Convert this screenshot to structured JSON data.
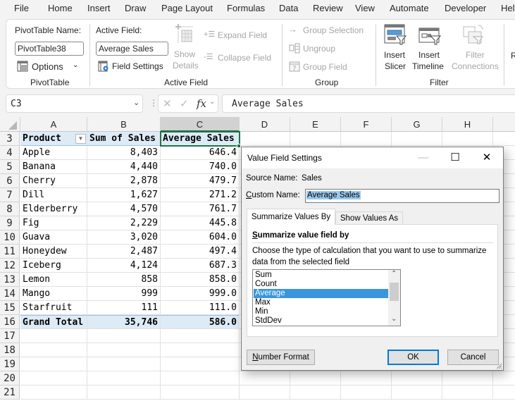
{
  "menu": {
    "tabs": [
      "File",
      "Home",
      "Insert",
      "Draw",
      "Page Layout",
      "Formulas",
      "Data",
      "Review",
      "View",
      "Automate",
      "Developer",
      "Hel"
    ]
  },
  "ribbon": {
    "pivottable": {
      "name_label": "PivotTable Name:",
      "name_value": "PivotTable38",
      "options_label": "Options",
      "group_label": "PivotTable"
    },
    "active_field": {
      "label": "Active Field:",
      "value": "Average Sales",
      "field_settings_label": "Field Settings",
      "show_details_label_1": "Show",
      "show_details_label_2": "Details",
      "expand_label": "Expand Field",
      "collapse_label": "Collapse Field",
      "group_label": "Active Field"
    },
    "group": {
      "group_selection_label": "Group Selection",
      "ungroup_label": "Ungroup",
      "group_field_label": "Group Field",
      "group_label": "Group"
    },
    "filter": {
      "insert_slicer_1": "Insert",
      "insert_slicer_2": "Slicer",
      "insert_timeline_1": "Insert",
      "insert_timeline_2": "Timeline",
      "filter_connections_1": "Filter",
      "filter_connections_2": "Connections",
      "group_label": "Filter"
    },
    "partial_next": "R"
  },
  "formula_bar": {
    "name_box": "C3",
    "fx_label": "fx",
    "formula": "Average Sales"
  },
  "grid": {
    "columns": [
      "A",
      "B",
      "C",
      "D",
      "E",
      "F",
      "G",
      "H"
    ],
    "selected_column": "C",
    "rows": [
      {
        "num": "3",
        "a": "Product",
        "b": "Sum of Sales",
        "c": "Average Sales",
        "kind": "header"
      },
      {
        "num": "4",
        "a": "Apple",
        "b": "8,403",
        "c": "646.4"
      },
      {
        "num": "5",
        "a": "Banana",
        "b": "4,440",
        "c": "740.0"
      },
      {
        "num": "6",
        "a": "Cherry",
        "b": "2,878",
        "c": "479.7"
      },
      {
        "num": "7",
        "a": "Dill",
        "b": "1,627",
        "c": "271.2"
      },
      {
        "num": "8",
        "a": "Elderberry",
        "b": "4,570",
        "c": "761.7"
      },
      {
        "num": "9",
        "a": "Fig",
        "b": "2,229",
        "c": "445.8"
      },
      {
        "num": "10",
        "a": "Guava",
        "b": "3,020",
        "c": "604.0"
      },
      {
        "num": "11",
        "a": "Honeydew",
        "b": "2,487",
        "c": "497.4"
      },
      {
        "num": "12",
        "a": "Iceberg",
        "b": "4,124",
        "c": "687.3"
      },
      {
        "num": "13",
        "a": "Lemon",
        "b": "858",
        "c": "858.0"
      },
      {
        "num": "14",
        "a": "Mango",
        "b": "999",
        "c": "999.0"
      },
      {
        "num": "15",
        "a": "Starfruit",
        "b": "111",
        "c": "111.0"
      },
      {
        "num": "16",
        "a": "Grand Total",
        "b": "35,746",
        "c": "586.0",
        "kind": "total"
      },
      {
        "num": "17",
        "a": "",
        "b": "",
        "c": ""
      },
      {
        "num": "18",
        "a": "",
        "b": "",
        "c": ""
      },
      {
        "num": "19",
        "a": "",
        "b": "",
        "c": ""
      },
      {
        "num": "20",
        "a": "",
        "b": "",
        "c": ""
      },
      {
        "num": "21",
        "a": "",
        "b": "",
        "c": ""
      }
    ]
  },
  "dialog": {
    "title": "Value Field Settings",
    "source_name_label": "Source Name:",
    "source_name_value": "Sales",
    "custom_name_label_u": "C",
    "custom_name_label_rest": "ustom Name:",
    "custom_name_value": "Average Sales",
    "tabs": [
      "Summarize Values By",
      "Show Values As"
    ],
    "active_tab": "Summarize Values By",
    "section_heading_u": "S",
    "section_heading_rest": "ummarize value field by",
    "description": "Choose the type of calculation that you want to use to summarize data from the selected field",
    "options": [
      "Sum",
      "Count",
      "Average",
      "Max",
      "Min",
      "StdDev"
    ],
    "selected_option": "Average",
    "number_format_u": "N",
    "number_format_rest": "umber Format",
    "ok_label": "OK",
    "cancel_label": "Cancel"
  },
  "colors": {
    "accent_green": "#217346",
    "pivot_header_fill": "#ddebf7",
    "selection_blue": "#3a96dd",
    "default_button_border": "#0078d7"
  }
}
